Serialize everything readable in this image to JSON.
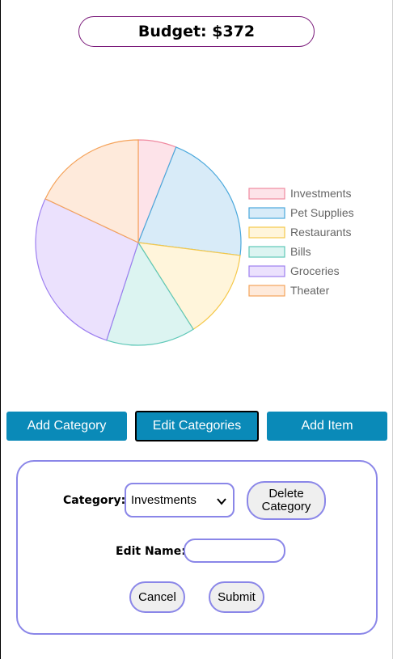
{
  "header": {
    "budget_label": "Budget: $372"
  },
  "chart_data": {
    "type": "pie",
    "title": "",
    "legend_position": "right",
    "categories": [
      "Investments",
      "Pet Supplies",
      "Restaurants",
      "Bills",
      "Groceries",
      "Theater"
    ],
    "values": [
      6,
      21,
      14,
      14,
      27,
      18
    ],
    "border_colors": [
      "#f08aa0",
      "#4aa8dc",
      "#f5c84a",
      "#5fc8b8",
      "#9c7ef0",
      "#f5a35a"
    ],
    "fill_colors": [
      "#fde3e9",
      "#d8ebf8",
      "#fff5db",
      "#dcf4f1",
      "#ebe1fd",
      "#feeadb"
    ]
  },
  "actions": {
    "add_category": "Add Category",
    "edit_categories": "Edit Categories",
    "add_item": "Add Item"
  },
  "edit_form": {
    "category_label": "Category:",
    "category_selected": "Investments",
    "delete_label_line1": "Delete",
    "delete_label_line2": "Category",
    "edit_name_label": "Edit Name:",
    "edit_name_value": "",
    "cancel_label": "Cancel",
    "submit_label": "Submit"
  }
}
